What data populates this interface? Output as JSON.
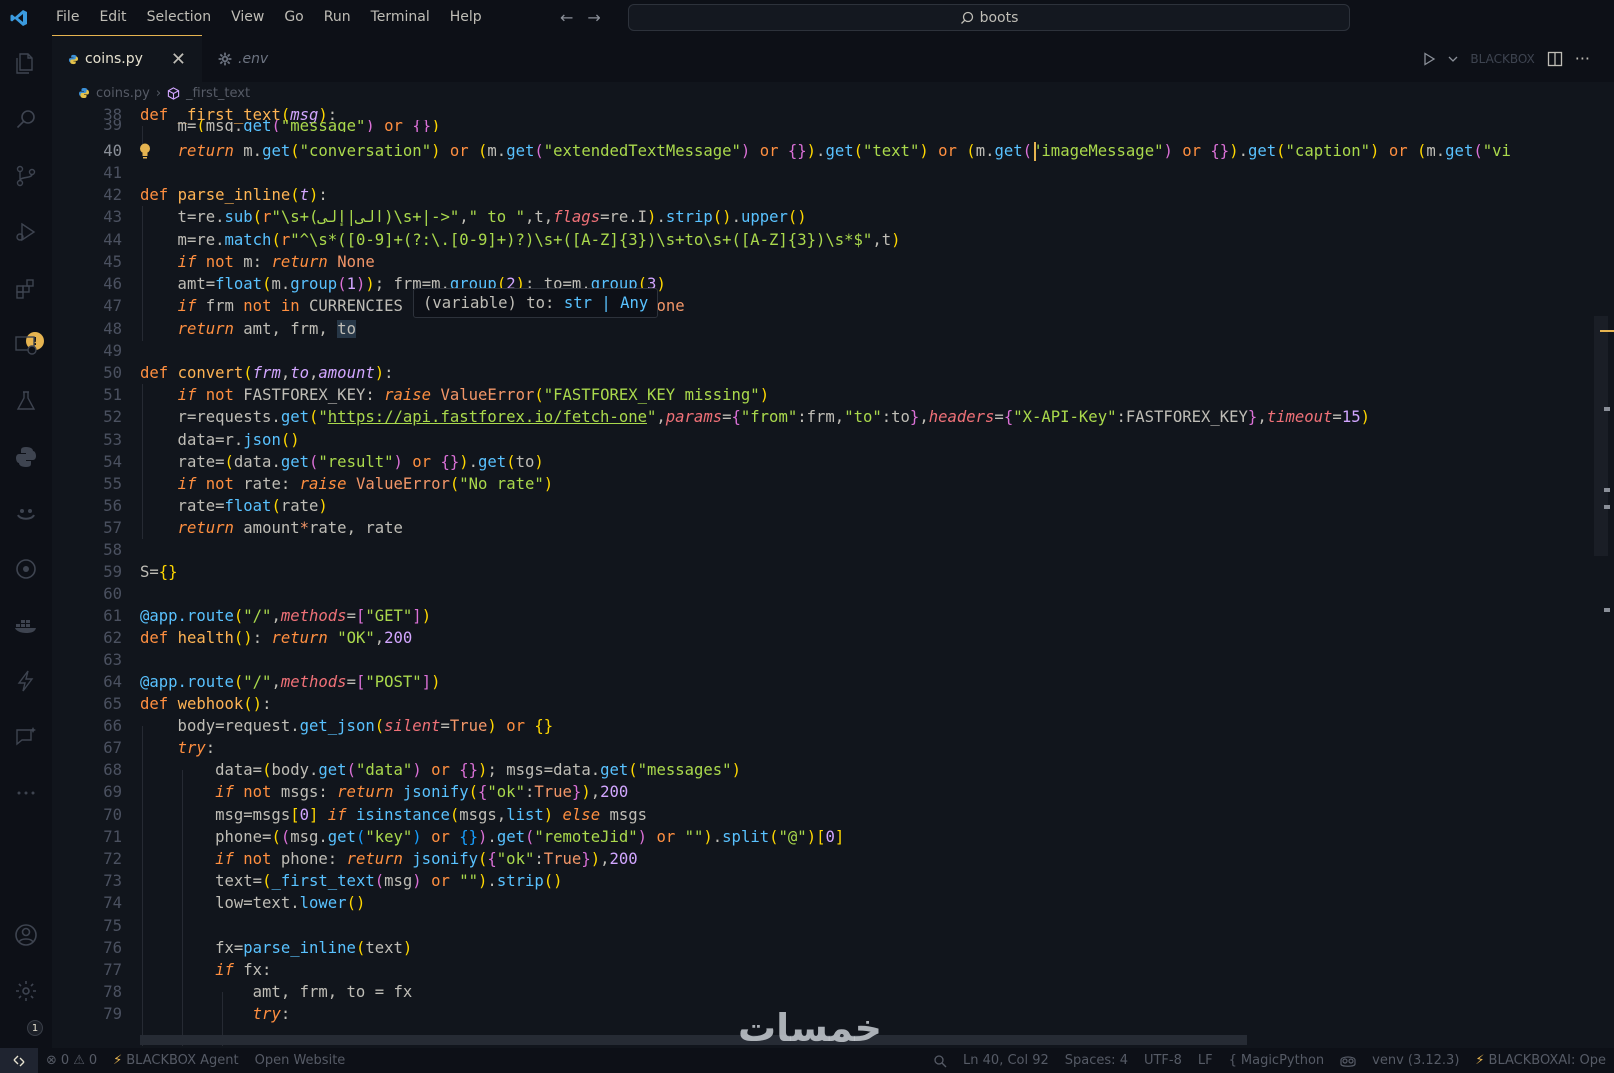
{
  "menu": [
    "File",
    "Edit",
    "Selection",
    "View",
    "Go",
    "Run",
    "Terminal",
    "Help"
  ],
  "search": {
    "text": "boots"
  },
  "tabs": [
    {
      "label": "coins.py",
      "close": "✕"
    },
    {
      "label": ".env"
    }
  ],
  "editor_actions": {
    "blackbox": "BLACKBOX"
  },
  "breadcrumb": {
    "file": "coins.py",
    "symbol": "_first_text",
    "separator": "›"
  },
  "line_numbers": [
    "38",
    "39",
    "40",
    "41",
    "42",
    "43",
    "44",
    "45",
    "46",
    "47",
    "48",
    "49",
    "50",
    "51",
    "52",
    "53",
    "54",
    "55",
    "56",
    "57",
    "58",
    "59",
    "60",
    "61",
    "62",
    "63",
    "64",
    "65",
    "66",
    "67",
    "68",
    "69",
    "70",
    "71",
    "72",
    "73",
    "74",
    "75",
    "76",
    "77",
    "78",
    "79"
  ],
  "hover": {
    "prefix": "(variable) to: ",
    "type": "str | Any"
  },
  "activity_badge": "1",
  "status": {
    "errors": "0",
    "warnings": "0",
    "agent": "BLACKBOX Agent",
    "open_website": "Open Website",
    "position": "Ln 40, Col 92",
    "spaces": "Spaces: 4",
    "encoding": "UTF-8",
    "eol": "LF",
    "language": "MagicPython",
    "venv": "venv (3.12.3)",
    "blackboxai": "BLACKBOXAI: Ope"
  },
  "watermark": "خمسات",
  "colors": {
    "accent": "#e6b450",
    "background": "#11151c",
    "keyword": "#ff8f40",
    "string": "#aad94c",
    "function": "#ffb454"
  }
}
